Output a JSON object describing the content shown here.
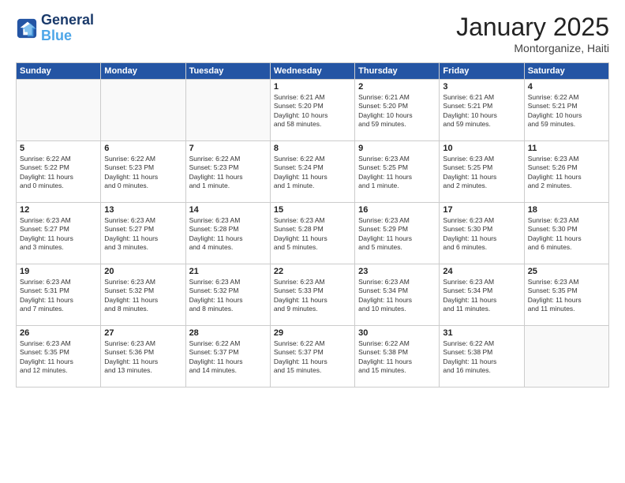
{
  "header": {
    "logo_line1": "General",
    "logo_line2": "Blue",
    "month": "January 2025",
    "location": "Montorganize, Haiti"
  },
  "weekdays": [
    "Sunday",
    "Monday",
    "Tuesday",
    "Wednesday",
    "Thursday",
    "Friday",
    "Saturday"
  ],
  "weeks": [
    [
      {
        "day": "",
        "info": ""
      },
      {
        "day": "",
        "info": ""
      },
      {
        "day": "",
        "info": ""
      },
      {
        "day": "1",
        "info": "Sunrise: 6:21 AM\nSunset: 5:20 PM\nDaylight: 10 hours\nand 58 minutes."
      },
      {
        "day": "2",
        "info": "Sunrise: 6:21 AM\nSunset: 5:20 PM\nDaylight: 10 hours\nand 59 minutes."
      },
      {
        "day": "3",
        "info": "Sunrise: 6:21 AM\nSunset: 5:21 PM\nDaylight: 10 hours\nand 59 minutes."
      },
      {
        "day": "4",
        "info": "Sunrise: 6:22 AM\nSunset: 5:21 PM\nDaylight: 10 hours\nand 59 minutes."
      }
    ],
    [
      {
        "day": "5",
        "info": "Sunrise: 6:22 AM\nSunset: 5:22 PM\nDaylight: 11 hours\nand 0 minutes."
      },
      {
        "day": "6",
        "info": "Sunrise: 6:22 AM\nSunset: 5:23 PM\nDaylight: 11 hours\nand 0 minutes."
      },
      {
        "day": "7",
        "info": "Sunrise: 6:22 AM\nSunset: 5:23 PM\nDaylight: 11 hours\nand 1 minute."
      },
      {
        "day": "8",
        "info": "Sunrise: 6:22 AM\nSunset: 5:24 PM\nDaylight: 11 hours\nand 1 minute."
      },
      {
        "day": "9",
        "info": "Sunrise: 6:23 AM\nSunset: 5:25 PM\nDaylight: 11 hours\nand 1 minute."
      },
      {
        "day": "10",
        "info": "Sunrise: 6:23 AM\nSunset: 5:25 PM\nDaylight: 11 hours\nand 2 minutes."
      },
      {
        "day": "11",
        "info": "Sunrise: 6:23 AM\nSunset: 5:26 PM\nDaylight: 11 hours\nand 2 minutes."
      }
    ],
    [
      {
        "day": "12",
        "info": "Sunrise: 6:23 AM\nSunset: 5:27 PM\nDaylight: 11 hours\nand 3 minutes."
      },
      {
        "day": "13",
        "info": "Sunrise: 6:23 AM\nSunset: 5:27 PM\nDaylight: 11 hours\nand 3 minutes."
      },
      {
        "day": "14",
        "info": "Sunrise: 6:23 AM\nSunset: 5:28 PM\nDaylight: 11 hours\nand 4 minutes."
      },
      {
        "day": "15",
        "info": "Sunrise: 6:23 AM\nSunset: 5:28 PM\nDaylight: 11 hours\nand 5 minutes."
      },
      {
        "day": "16",
        "info": "Sunrise: 6:23 AM\nSunset: 5:29 PM\nDaylight: 11 hours\nand 5 minutes."
      },
      {
        "day": "17",
        "info": "Sunrise: 6:23 AM\nSunset: 5:30 PM\nDaylight: 11 hours\nand 6 minutes."
      },
      {
        "day": "18",
        "info": "Sunrise: 6:23 AM\nSunset: 5:30 PM\nDaylight: 11 hours\nand 6 minutes."
      }
    ],
    [
      {
        "day": "19",
        "info": "Sunrise: 6:23 AM\nSunset: 5:31 PM\nDaylight: 11 hours\nand 7 minutes."
      },
      {
        "day": "20",
        "info": "Sunrise: 6:23 AM\nSunset: 5:32 PM\nDaylight: 11 hours\nand 8 minutes."
      },
      {
        "day": "21",
        "info": "Sunrise: 6:23 AM\nSunset: 5:32 PM\nDaylight: 11 hours\nand 8 minutes."
      },
      {
        "day": "22",
        "info": "Sunrise: 6:23 AM\nSunset: 5:33 PM\nDaylight: 11 hours\nand 9 minutes."
      },
      {
        "day": "23",
        "info": "Sunrise: 6:23 AM\nSunset: 5:34 PM\nDaylight: 11 hours\nand 10 minutes."
      },
      {
        "day": "24",
        "info": "Sunrise: 6:23 AM\nSunset: 5:34 PM\nDaylight: 11 hours\nand 11 minutes."
      },
      {
        "day": "25",
        "info": "Sunrise: 6:23 AM\nSunset: 5:35 PM\nDaylight: 11 hours\nand 11 minutes."
      }
    ],
    [
      {
        "day": "26",
        "info": "Sunrise: 6:23 AM\nSunset: 5:35 PM\nDaylight: 11 hours\nand 12 minutes."
      },
      {
        "day": "27",
        "info": "Sunrise: 6:23 AM\nSunset: 5:36 PM\nDaylight: 11 hours\nand 13 minutes."
      },
      {
        "day": "28",
        "info": "Sunrise: 6:22 AM\nSunset: 5:37 PM\nDaylight: 11 hours\nand 14 minutes."
      },
      {
        "day": "29",
        "info": "Sunrise: 6:22 AM\nSunset: 5:37 PM\nDaylight: 11 hours\nand 15 minutes."
      },
      {
        "day": "30",
        "info": "Sunrise: 6:22 AM\nSunset: 5:38 PM\nDaylight: 11 hours\nand 15 minutes."
      },
      {
        "day": "31",
        "info": "Sunrise: 6:22 AM\nSunset: 5:38 PM\nDaylight: 11 hours\nand 16 minutes."
      },
      {
        "day": "",
        "info": ""
      }
    ]
  ]
}
